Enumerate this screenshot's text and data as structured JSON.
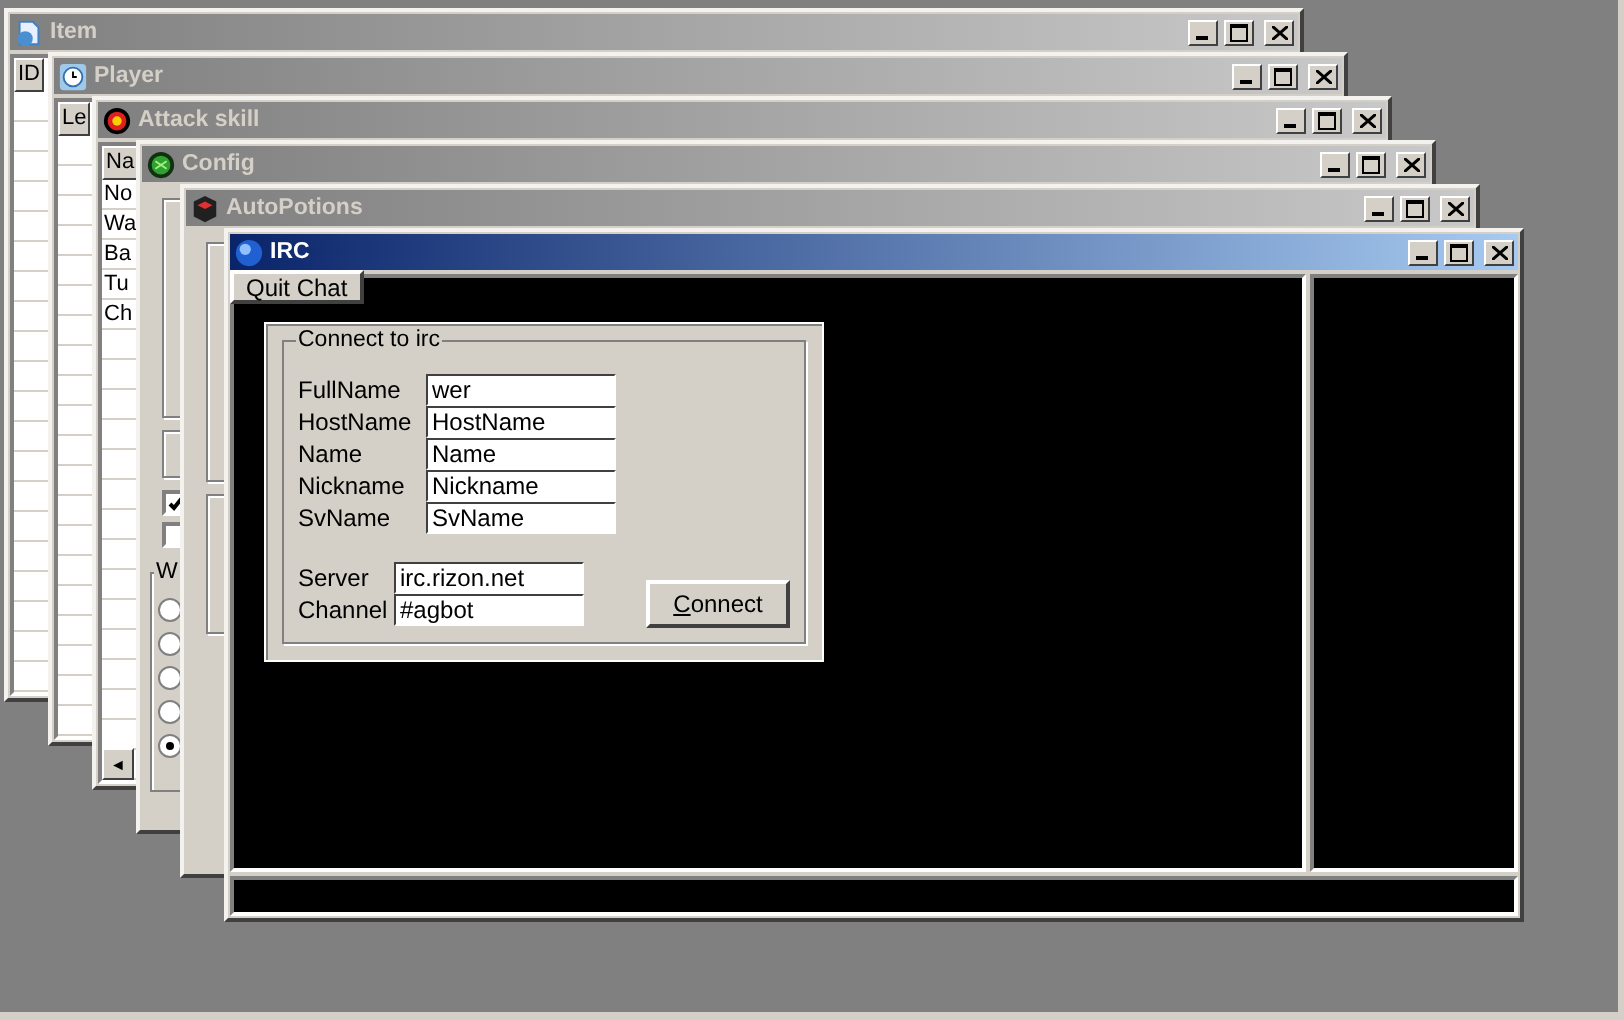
{
  "windows": [
    {
      "kind": "list",
      "title": "Item",
      "active": false,
      "column": "ID"
    },
    {
      "kind": "list",
      "title": "Player",
      "active": false,
      "column": "Le"
    },
    {
      "kind": "list",
      "title": "Attack skill",
      "active": false,
      "column": "Na",
      "rows": [
        "No",
        "Wa",
        "Ba",
        "Tu",
        "Ch"
      ],
      "scroll_arrow": "◄"
    },
    {
      "kind": "config",
      "title": "Config",
      "active": false,
      "checkboxes": [
        {
          "checked": true
        },
        {
          "checked": false
        }
      ],
      "group_label": "W",
      "radios": [
        {
          "selected": false
        },
        {
          "selected": false
        },
        {
          "selected": false
        },
        {
          "selected": false
        },
        {
          "selected": true
        }
      ]
    },
    {
      "kind": "potions",
      "title": "AutoPotions",
      "active": false
    },
    {
      "kind": "irc",
      "title": "IRC",
      "active": true,
      "quit_button": "Quit Chat",
      "connect": {
        "legend": "Connect to irc",
        "fields": [
          {
            "label": "FullName",
            "value": "wer"
          },
          {
            "label": "HostName",
            "value": "HostName"
          },
          {
            "label": "Name",
            "value": "Name"
          },
          {
            "label": "Nickname",
            "value": "Nickname"
          },
          {
            "label": "SvName",
            "value": "SvName"
          }
        ],
        "server_fields": [
          {
            "label": "Server",
            "value": "irc.rizon.net"
          },
          {
            "label": "Channel",
            "value": "#agbot"
          }
        ],
        "button": "Connect"
      }
    }
  ]
}
